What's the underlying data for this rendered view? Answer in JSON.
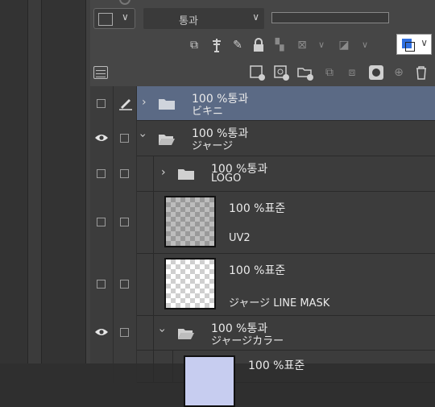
{
  "blend_mode": {
    "selected": "통과"
  },
  "layers": [
    {
      "name": "ビキニ",
      "mode": "100 %통과",
      "type": "folder",
      "expanded": false,
      "selected": true
    },
    {
      "name": "ジャージ",
      "mode": "100 %통과",
      "type": "folder",
      "expanded": true,
      "visible": true
    },
    {
      "name": "LOGO",
      "mode": "100 %통과",
      "type": "folder",
      "expanded": false
    },
    {
      "name": "UV2",
      "mode": "100 %표준",
      "type": "raster"
    },
    {
      "name": "ジャージ LINE MASK",
      "mode": "100 %표준",
      "type": "raster"
    },
    {
      "name": "ジャージカラー",
      "mode": "100 %통과",
      "type": "folder",
      "expanded": true,
      "visible": true
    },
    {
      "name": "",
      "mode": "100 %표준",
      "type": "raster"
    }
  ],
  "colors": {
    "selected_row": "#5b6a85",
    "accent_blue": "#2f6fe0"
  }
}
